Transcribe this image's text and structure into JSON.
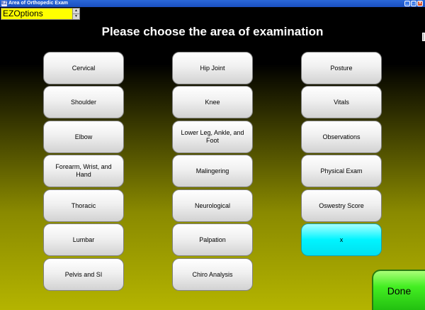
{
  "window": {
    "title": "Area of Orthopedic Exam",
    "icon_label": "EZ",
    "minimize_glyph": "_",
    "maximize_glyph": "□",
    "close_glyph": "×"
  },
  "ez_options": {
    "label": "EZOptions",
    "spin_up": "▲",
    "spin_down": "▼"
  },
  "heading": "Please choose the area of examination",
  "columns": [
    [
      "Cervical",
      "Shoulder",
      "Elbow",
      "Forearm, Wrist, and Hand",
      "Thoracic",
      "Lumbar",
      "Pelvis and SI"
    ],
    [
      "Hip Joint",
      "Knee",
      "Lower Leg, Ankle, and Foot",
      "Malingering",
      "Neurological",
      "Palpation",
      "Chiro Analysis"
    ],
    [
      "Posture",
      "Vitals",
      "Observations",
      "Physical Exam",
      "Oswestry Score",
      "x"
    ]
  ],
  "done_label": "Done",
  "colors": {
    "background_top": "#000000",
    "background_bottom": "#b4b400",
    "ez_select_bg": "#ffff00",
    "highlight_button": "#00f4ff",
    "done_button": "#44ee22"
  }
}
